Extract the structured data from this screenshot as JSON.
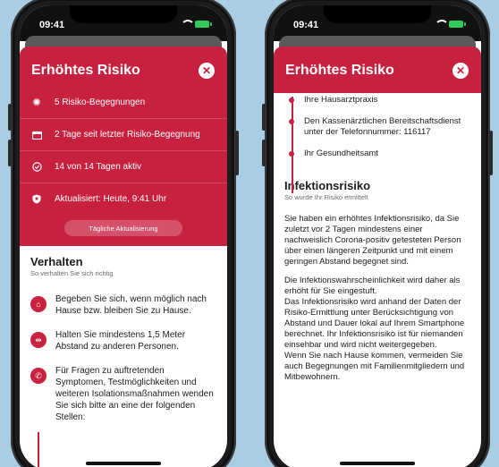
{
  "status_time": "09:41",
  "accent_color": "#c8213f",
  "left_screen": {
    "title": "Erhöhtes Risiko",
    "close_symbol": "✕",
    "info_rows": [
      {
        "icon": "virus-icon",
        "text": "5 Risiko-Begegnungen"
      },
      {
        "icon": "calendar-icon",
        "text": "2 Tage seit letzter Risiko-Begegnung"
      },
      {
        "icon": "check-circle-icon",
        "text": "14 von 14 Tagen aktiv"
      },
      {
        "icon": "shield-icon",
        "text": "Aktualisiert: Heute, 9:41 Uhr"
      }
    ],
    "refresh_button": "Tägliche Aktualisierung",
    "section_title": "Verhalten",
    "section_subtitle": "So verhalten Sie sich richtig",
    "rules": [
      {
        "icon": "home-icon",
        "text": "Begeben Sie sich, wenn möglich nach Hause bzw. bleiben Sie zu Hause."
      },
      {
        "icon": "distance-icon",
        "text": "Halten Sie mindestens 1,5 Meter Abstand zu anderen Personen."
      },
      {
        "icon": "phone-icon",
        "text": "Für Fragen zu auftretenden Symptomen, Testmöglichkeiten und weiteren Isolationsmaßnahmen wenden Sie sich bitte an eine der folgenden Stellen:"
      }
    ]
  },
  "right_screen": {
    "title": "Erhöhtes Risiko",
    "close_symbol": "✕",
    "contacts": [
      "Ihre Hausarztpraxis",
      "Den Kassenärztlichen Bereitschaftsdienst unter der Telefonnummer: 116117",
      "Ihr Gesundheitsamt"
    ],
    "section_title": "Infektionsrisiko",
    "section_subtitle": "So wurde Ihr Risiko ermittelt",
    "paragraph_1": "Sie haben ein erhöhtes Infektionsrisiko, da Sie zuletzt vor 2 Tagen mindestens einer nachweislich Corona-positiv getesteten Person über einen längeren Zeitpunkt und mit einem geringen Abstand begegnet sind.",
    "paragraph_2": "Die Infektionswahrscheinlichkeit wird daher als erhöht für Sie eingestuft.",
    "paragraph_3": "Das Infektionsrisiko wird anhand der Daten der Risiko-Ermittlung unter Berücksichtigung von Abstand und Dauer lokal auf Ihrem Smartphone berechnet. Ihr Infektionsrisiko ist für niemanden einsehbar und wird nicht weitergegeben.",
    "paragraph_4": "Wenn Sie nach Hause kommen, vermeiden Sie auch Begegnungen mit Familienmitgliedern und Mitbewohnern."
  }
}
